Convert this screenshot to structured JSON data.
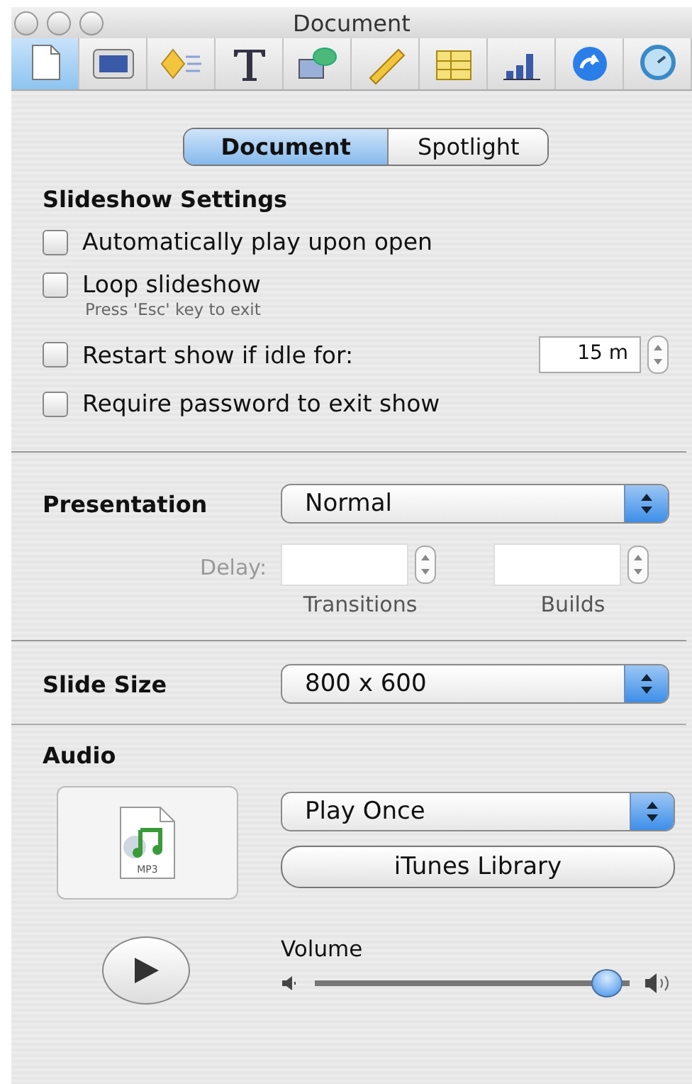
{
  "window": {
    "title": "Document"
  },
  "toolbar": [
    {
      "kind": "document",
      "selected": true
    },
    {
      "kind": "slide",
      "selected": false
    },
    {
      "kind": "transition",
      "selected": false
    },
    {
      "kind": "text",
      "selected": false
    },
    {
      "kind": "graphic",
      "selected": false
    },
    {
      "kind": "ruler",
      "selected": false
    },
    {
      "kind": "table",
      "selected": false
    },
    {
      "kind": "chart",
      "selected": false
    },
    {
      "kind": "link",
      "selected": false
    },
    {
      "kind": "media",
      "selected": false
    }
  ],
  "tabs": [
    {
      "label": "Document",
      "selected": true
    },
    {
      "label": "Spotlight",
      "selected": false
    }
  ],
  "slideshow_settings": {
    "heading": "Slideshow Settings",
    "options": [
      {
        "label": "Automatically play upon open",
        "checked": false
      },
      {
        "label": "Loop slideshow",
        "checked": false,
        "hint": "Press 'Esc' key to exit"
      },
      {
        "label": "Restart show if idle for:",
        "checked": false,
        "value": "15 m"
      },
      {
        "label": "Require password to exit show",
        "checked": false
      }
    ]
  },
  "presentation": {
    "label": "Presentation",
    "value": "Normal"
  },
  "delay": {
    "label": "Delay:",
    "disabled": true,
    "fields": [
      {
        "caption": "Transitions"
      },
      {
        "caption": "Builds"
      }
    ]
  },
  "slide_size": {
    "label": "Slide Size",
    "value": "800 x 600"
  },
  "audio": {
    "heading": "Audio",
    "file_label": "MP3",
    "mode": "Play Once",
    "button": "iTunes Library",
    "volume": {
      "label": "Volume",
      "level": 0.93
    }
  }
}
